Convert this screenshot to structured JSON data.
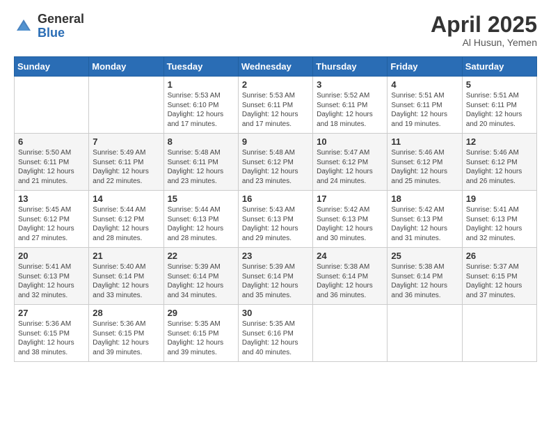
{
  "logo": {
    "general": "General",
    "blue": "Blue"
  },
  "header": {
    "month": "April 2025",
    "location": "Al Husun, Yemen"
  },
  "weekdays": [
    "Sunday",
    "Monday",
    "Tuesday",
    "Wednesday",
    "Thursday",
    "Friday",
    "Saturday"
  ],
  "rows": [
    [
      {
        "day": "",
        "info": ""
      },
      {
        "day": "",
        "info": ""
      },
      {
        "day": "1",
        "info": "Sunrise: 5:53 AM\nSunset: 6:10 PM\nDaylight: 12 hours and 17 minutes."
      },
      {
        "day": "2",
        "info": "Sunrise: 5:53 AM\nSunset: 6:11 PM\nDaylight: 12 hours and 17 minutes."
      },
      {
        "day": "3",
        "info": "Sunrise: 5:52 AM\nSunset: 6:11 PM\nDaylight: 12 hours and 18 minutes."
      },
      {
        "day": "4",
        "info": "Sunrise: 5:51 AM\nSunset: 6:11 PM\nDaylight: 12 hours and 19 minutes."
      },
      {
        "day": "5",
        "info": "Sunrise: 5:51 AM\nSunset: 6:11 PM\nDaylight: 12 hours and 20 minutes."
      }
    ],
    [
      {
        "day": "6",
        "info": "Sunrise: 5:50 AM\nSunset: 6:11 PM\nDaylight: 12 hours and 21 minutes."
      },
      {
        "day": "7",
        "info": "Sunrise: 5:49 AM\nSunset: 6:11 PM\nDaylight: 12 hours and 22 minutes."
      },
      {
        "day": "8",
        "info": "Sunrise: 5:48 AM\nSunset: 6:11 PM\nDaylight: 12 hours and 23 minutes."
      },
      {
        "day": "9",
        "info": "Sunrise: 5:48 AM\nSunset: 6:12 PM\nDaylight: 12 hours and 23 minutes."
      },
      {
        "day": "10",
        "info": "Sunrise: 5:47 AM\nSunset: 6:12 PM\nDaylight: 12 hours and 24 minutes."
      },
      {
        "day": "11",
        "info": "Sunrise: 5:46 AM\nSunset: 6:12 PM\nDaylight: 12 hours and 25 minutes."
      },
      {
        "day": "12",
        "info": "Sunrise: 5:46 AM\nSunset: 6:12 PM\nDaylight: 12 hours and 26 minutes."
      }
    ],
    [
      {
        "day": "13",
        "info": "Sunrise: 5:45 AM\nSunset: 6:12 PM\nDaylight: 12 hours and 27 minutes."
      },
      {
        "day": "14",
        "info": "Sunrise: 5:44 AM\nSunset: 6:12 PM\nDaylight: 12 hours and 28 minutes."
      },
      {
        "day": "15",
        "info": "Sunrise: 5:44 AM\nSunset: 6:13 PM\nDaylight: 12 hours and 28 minutes."
      },
      {
        "day": "16",
        "info": "Sunrise: 5:43 AM\nSunset: 6:13 PM\nDaylight: 12 hours and 29 minutes."
      },
      {
        "day": "17",
        "info": "Sunrise: 5:42 AM\nSunset: 6:13 PM\nDaylight: 12 hours and 30 minutes."
      },
      {
        "day": "18",
        "info": "Sunrise: 5:42 AM\nSunset: 6:13 PM\nDaylight: 12 hours and 31 minutes."
      },
      {
        "day": "19",
        "info": "Sunrise: 5:41 AM\nSunset: 6:13 PM\nDaylight: 12 hours and 32 minutes."
      }
    ],
    [
      {
        "day": "20",
        "info": "Sunrise: 5:41 AM\nSunset: 6:13 PM\nDaylight: 12 hours and 32 minutes."
      },
      {
        "day": "21",
        "info": "Sunrise: 5:40 AM\nSunset: 6:14 PM\nDaylight: 12 hours and 33 minutes."
      },
      {
        "day": "22",
        "info": "Sunrise: 5:39 AM\nSunset: 6:14 PM\nDaylight: 12 hours and 34 minutes."
      },
      {
        "day": "23",
        "info": "Sunrise: 5:39 AM\nSunset: 6:14 PM\nDaylight: 12 hours and 35 minutes."
      },
      {
        "day": "24",
        "info": "Sunrise: 5:38 AM\nSunset: 6:14 PM\nDaylight: 12 hours and 36 minutes."
      },
      {
        "day": "25",
        "info": "Sunrise: 5:38 AM\nSunset: 6:14 PM\nDaylight: 12 hours and 36 minutes."
      },
      {
        "day": "26",
        "info": "Sunrise: 5:37 AM\nSunset: 6:15 PM\nDaylight: 12 hours and 37 minutes."
      }
    ],
    [
      {
        "day": "27",
        "info": "Sunrise: 5:36 AM\nSunset: 6:15 PM\nDaylight: 12 hours and 38 minutes."
      },
      {
        "day": "28",
        "info": "Sunrise: 5:36 AM\nSunset: 6:15 PM\nDaylight: 12 hours and 39 minutes."
      },
      {
        "day": "29",
        "info": "Sunrise: 5:35 AM\nSunset: 6:15 PM\nDaylight: 12 hours and 39 minutes."
      },
      {
        "day": "30",
        "info": "Sunrise: 5:35 AM\nSunset: 6:16 PM\nDaylight: 12 hours and 40 minutes."
      },
      {
        "day": "",
        "info": ""
      },
      {
        "day": "",
        "info": ""
      },
      {
        "day": "",
        "info": ""
      }
    ]
  ]
}
